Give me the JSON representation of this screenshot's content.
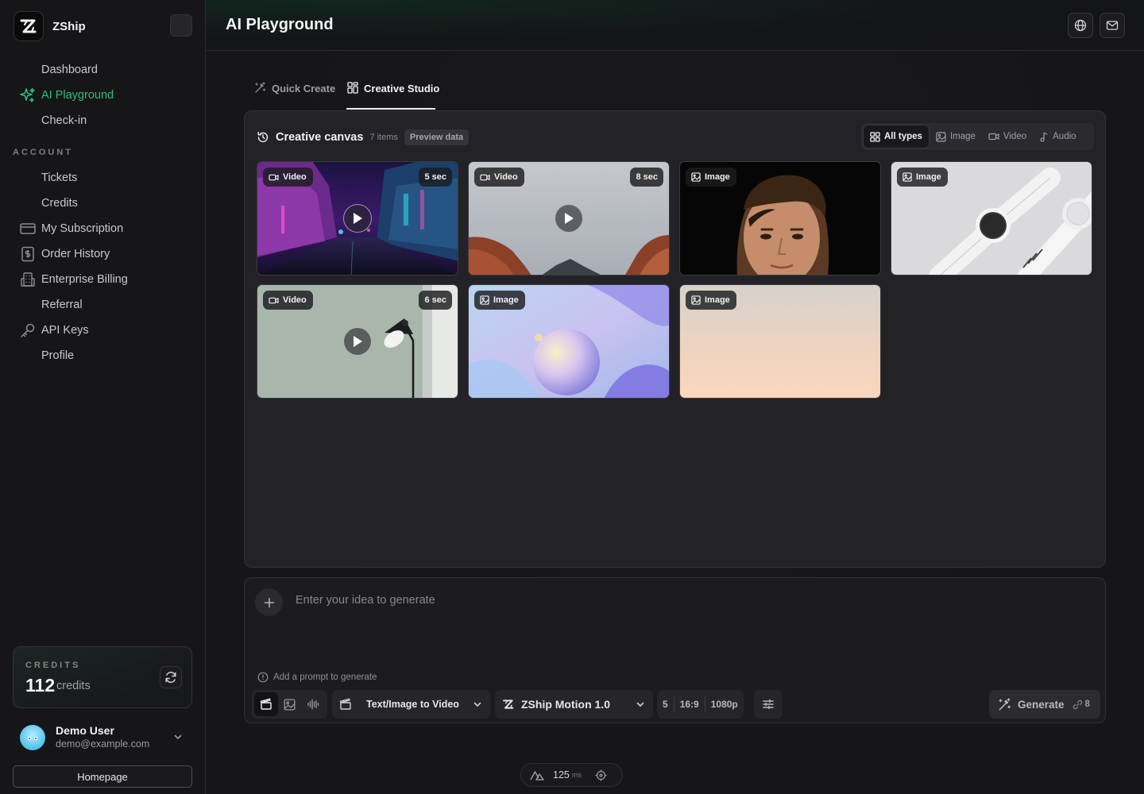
{
  "app": {
    "name": "ZShip"
  },
  "sidebar": {
    "nav": [
      {
        "label": "Dashboard",
        "icon": "none"
      },
      {
        "label": "AI Playground",
        "icon": "sparkles-icon",
        "active": true
      },
      {
        "label": "Check-in",
        "icon": "none"
      }
    ],
    "section_label": "ACCOUNT",
    "account_items": [
      {
        "label": "Tickets",
        "icon": "none"
      },
      {
        "label": "Credits",
        "icon": "none"
      },
      {
        "label": "My Subscription",
        "icon": "credit-card-icon"
      },
      {
        "label": "Order History",
        "icon": "receipt-dollar-icon"
      },
      {
        "label": "Enterprise Billing",
        "icon": "building-icon"
      },
      {
        "label": "Referral",
        "icon": "none"
      },
      {
        "label": "API Keys",
        "icon": "key-icon"
      },
      {
        "label": "Profile",
        "icon": "none"
      }
    ],
    "credits": {
      "title": "CREDITS",
      "amount": "112",
      "unit": "credits"
    },
    "user": {
      "name": "Demo User",
      "email": "demo@example.com"
    },
    "homepage_label": "Homepage"
  },
  "header": {
    "title": "AI Playground"
  },
  "tabs": [
    {
      "label": "Quick Create",
      "icon": "magic-wand-icon",
      "active": false
    },
    {
      "label": "Creative Studio",
      "icon": "layout-grid-icon",
      "active": true
    }
  ],
  "canvas": {
    "title": "Creative canvas",
    "count": "7 items",
    "badge": "Preview data",
    "filters": [
      {
        "label": "All types",
        "icon": "grid-icon",
        "active": true
      },
      {
        "label": "Image",
        "icon": "image-icon",
        "active": false
      },
      {
        "label": "Video",
        "icon": "video-icon",
        "active": false
      },
      {
        "label": "Audio",
        "icon": "music-note-icon",
        "active": false
      }
    ],
    "items": [
      {
        "type": "Video",
        "duration": "5 sec",
        "scene": "neon city street at night"
      },
      {
        "type": "Video",
        "duration": "8 sec",
        "scene": "red rocky desert under grey sky"
      },
      {
        "type": "Image",
        "duration": "",
        "scene": "portrait of man on black background"
      },
      {
        "type": "Image",
        "duration": "",
        "scene": "two white smartwatches"
      },
      {
        "type": "Video",
        "duration": "6 sec",
        "scene": "black desk lamp on green wall"
      },
      {
        "type": "Image",
        "duration": "",
        "scene": "abstract iridescent sphere"
      },
      {
        "type": "Image",
        "duration": "",
        "scene": "soft peach gradient sky"
      }
    ]
  },
  "prompt": {
    "placeholder": "Enter your idea to generate",
    "hint": "Add a prompt to generate",
    "mode_select": "Text/Image to Video",
    "model_select": "ZShip Motion 1.0",
    "params": [
      "5",
      "16:9",
      "1080p"
    ],
    "generate_label": "Generate",
    "generate_cost": "8"
  },
  "perf": {
    "value": "125",
    "unit": "ms"
  },
  "colors": {
    "accent": "#2bbf7a",
    "background": "#161618",
    "panel": "#232327"
  }
}
